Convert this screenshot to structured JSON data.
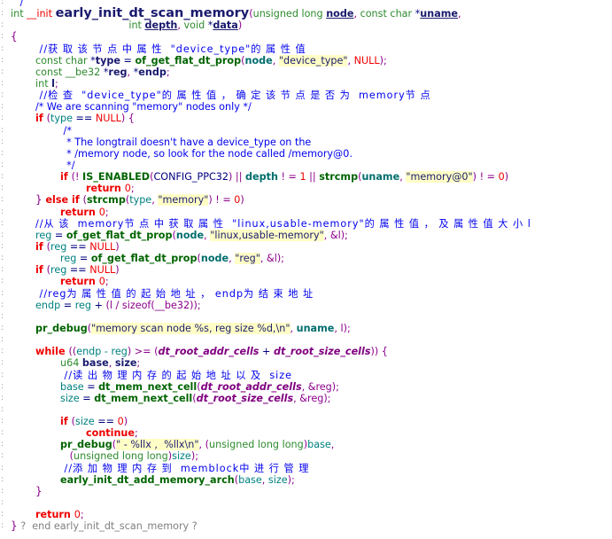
{
  "editor": {
    "gutter_mark": ":",
    "lines": [
      {
        "lv": 0,
        "tk": [
          [
            "   /",
            "c"
          ]
        ]
      },
      {
        "lv": 0,
        "tk": [
          [
            "int ",
            "t"
          ],
          [
            "__init ",
            "k0"
          ],
          [
            "early_init_dt_scan_memory",
            "fnbig"
          ],
          [
            "(",
            "p"
          ],
          [
            "unsigned long ",
            "t"
          ],
          [
            "node",
            "vu"
          ],
          [
            ", ",
            "p"
          ],
          [
            "const char ",
            "t"
          ],
          [
            "*",
            "x"
          ],
          [
            "uname",
            "vu"
          ],
          [
            ",",
            "p"
          ]
        ]
      },
      {
        "lv": 4,
        "tk": [
          [
            "      int ",
            "t"
          ],
          [
            "depth",
            "vu"
          ],
          [
            ", ",
            "p"
          ],
          [
            "void ",
            "t"
          ],
          [
            "*",
            "x"
          ],
          [
            "data",
            "vu"
          ],
          [
            ")",
            "p"
          ]
        ]
      },
      {
        "lv": 0,
        "tk": [
          [
            "{",
            "br"
          ]
        ]
      },
      {
        "lv": 1,
        "tk": [
          [
            " //获 取 该 节 点 中 属 性  \"device_type\"的 属 性 值",
            "cz"
          ]
        ]
      },
      {
        "lv": 1,
        "tk": [
          [
            "const char ",
            "t"
          ],
          [
            "*",
            "x"
          ],
          [
            "type",
            "v"
          ],
          [
            " = ",
            "x"
          ],
          [
            "of_get_flat_dt_prop",
            "f"
          ],
          [
            "(",
            "p"
          ],
          [
            "node",
            "tv"
          ],
          [
            ", ",
            "p"
          ],
          [
            "\"device_type\"",
            "s"
          ],
          [
            ", ",
            "p"
          ],
          [
            "NULL",
            "n"
          ],
          [
            ");",
            "p"
          ]
        ]
      },
      {
        "lv": 1,
        "tk": [
          [
            "const __be32 ",
            "t"
          ],
          [
            "*",
            "x"
          ],
          [
            "reg",
            "v"
          ],
          [
            ", ",
            "p"
          ],
          [
            "*",
            "x"
          ],
          [
            "endp",
            "v"
          ],
          [
            ";",
            "p"
          ]
        ]
      },
      {
        "lv": 1,
        "tk": [
          [
            "int ",
            "t"
          ],
          [
            "l",
            "v"
          ],
          [
            ";",
            "p"
          ]
        ]
      },
      {
        "lv": 1,
        "tk": [
          [
            " //检 查  \"device_type\"的 属 性 值 ， 确 定 该 节 点 是 否 为  memory节 点",
            "cz"
          ]
        ]
      },
      {
        "lv": 1,
        "tk": [
          [
            "/* We are scanning \"memory\" nodes only */",
            "c"
          ]
        ]
      },
      {
        "lv": 1,
        "tk": [
          [
            "if ",
            "k"
          ],
          [
            "(",
            "p"
          ],
          [
            "type",
            "l"
          ],
          [
            " == ",
            "x"
          ],
          [
            "NULL",
            "n"
          ],
          [
            ") {",
            "p"
          ]
        ]
      },
      {
        "lv": 2,
        "tk": [
          [
            " /*",
            "c"
          ]
        ]
      },
      {
        "lv": 2,
        "tk": [
          [
            "  * The longtrail doesn't have a device_type on the",
            "c"
          ]
        ]
      },
      {
        "lv": 2,
        "tk": [
          [
            "  * /memory node, so look for the node called /memory@0.",
            "c"
          ]
        ]
      },
      {
        "lv": 2,
        "tk": [
          [
            "  */",
            "c"
          ]
        ]
      },
      {
        "lv": 2,
        "tk": [
          [
            "if ",
            "k"
          ],
          [
            "(",
            "p"
          ],
          [
            "! ",
            "p"
          ],
          [
            "IS_ENABLED",
            "f"
          ],
          [
            "(",
            "p"
          ],
          [
            "CONFIG_PPC32",
            "x"
          ],
          [
            ") || ",
            "p"
          ],
          [
            "depth",
            "tv"
          ],
          [
            " ! = ",
            "p"
          ],
          [
            "1",
            "n"
          ],
          [
            " || ",
            "p"
          ],
          [
            "strcmp",
            "f"
          ],
          [
            "(",
            "p"
          ],
          [
            "uname",
            "tv"
          ],
          [
            ", ",
            "p"
          ],
          [
            "\"memory@0\"",
            "s"
          ],
          [
            ") ! = ",
            "p"
          ],
          [
            "0",
            "n"
          ],
          [
            ")",
            "p"
          ]
        ]
      },
      {
        "lv": 3,
        "tk": [
          [
            "return ",
            "k"
          ],
          [
            "0",
            "n"
          ],
          [
            ";",
            "p"
          ]
        ]
      },
      {
        "lv": 1,
        "tk": [
          [
            "} ",
            "br"
          ],
          [
            "else if ",
            "k"
          ],
          [
            "(",
            "p"
          ],
          [
            "strcmp",
            "f"
          ],
          [
            "(",
            "p"
          ],
          [
            "type",
            "l"
          ],
          [
            ", ",
            "p"
          ],
          [
            "\"memory\"",
            "s"
          ],
          [
            ") ! = ",
            "p"
          ],
          [
            "0",
            "n"
          ],
          [
            ")",
            "p"
          ]
        ]
      },
      {
        "lv": 2,
        "tk": [
          [
            "return ",
            "k"
          ],
          [
            "0",
            "n"
          ],
          [
            ";",
            "p"
          ]
        ]
      },
      {
        "lv": 1,
        "tk": [
          [
            "//从 该  memory节 点 中 获 取 属 性  \"linux,usable-memory\"的 属 性 值 ， 及 属 性 值 大 小 l",
            "cz"
          ]
        ]
      },
      {
        "lv": 1,
        "tk": [
          [
            "reg",
            "l"
          ],
          [
            " = ",
            "x"
          ],
          [
            "of_get_flat_dt_prop",
            "f"
          ],
          [
            "(",
            "p"
          ],
          [
            "node",
            "tv"
          ],
          [
            ", ",
            "p"
          ],
          [
            "\"linux,usable-memory\"",
            "s"
          ],
          [
            ", &l);",
            "p"
          ]
        ]
      },
      {
        "lv": 1,
        "tk": [
          [
            "if ",
            "k"
          ],
          [
            "(",
            "p"
          ],
          [
            "reg",
            "l"
          ],
          [
            " == ",
            "x"
          ],
          [
            "NULL",
            "n"
          ],
          [
            ")",
            "p"
          ]
        ]
      },
      {
        "lv": 2,
        "tk": [
          [
            "reg",
            "l"
          ],
          [
            " = ",
            "x"
          ],
          [
            "of_get_flat_dt_prop",
            "f"
          ],
          [
            "(",
            "p"
          ],
          [
            "node",
            "tv"
          ],
          [
            ", ",
            "p"
          ],
          [
            "\"reg\"",
            "s"
          ],
          [
            ", &l);",
            "p"
          ]
        ]
      },
      {
        "lv": 1,
        "tk": [
          [
            "if ",
            "k"
          ],
          [
            "(",
            "p"
          ],
          [
            "reg",
            "l"
          ],
          [
            " == ",
            "x"
          ],
          [
            "NULL",
            "n"
          ],
          [
            ")",
            "p"
          ]
        ]
      },
      {
        "lv": 2,
        "tk": [
          [
            "return ",
            "k"
          ],
          [
            "0",
            "n"
          ],
          [
            ";",
            "p"
          ]
        ]
      },
      {
        "lv": 1,
        "tk": [
          [
            " //reg为 属 性 值 的 起 始 地 址 ， endp为 结 束 地 址",
            "cz"
          ]
        ]
      },
      {
        "lv": 1,
        "tk": [
          [
            "endp",
            "l"
          ],
          [
            " = ",
            "x"
          ],
          [
            "reg",
            "l"
          ],
          [
            " + ",
            "x"
          ],
          [
            "(l / sizeof(__be32));",
            "p"
          ]
        ]
      },
      {
        "lv": 1,
        "tk": []
      },
      {
        "lv": 1,
        "tk": [
          [
            "pr_debug",
            "f"
          ],
          [
            "(",
            "p"
          ],
          [
            "\"memory scan node %s, reg size %d,\\n\"",
            "s"
          ],
          [
            ", ",
            "p"
          ],
          [
            "uname",
            "tv"
          ],
          [
            ", l);",
            "p"
          ]
        ]
      },
      {
        "lv": 1,
        "tk": []
      },
      {
        "lv": 1,
        "tk": [
          [
            "while ",
            "k"
          ],
          [
            "((",
            "p"
          ],
          [
            "endp - reg",
            "l"
          ],
          [
            ") >= (",
            "p"
          ],
          [
            "dt_root_addr_cells",
            "m"
          ],
          [
            " + ",
            "x"
          ],
          [
            "dt_root_size_cells",
            "m"
          ],
          [
            ")) {",
            "p"
          ]
        ]
      },
      {
        "lv": 2,
        "tk": [
          [
            "u64 ",
            "t"
          ],
          [
            "base",
            "v"
          ],
          [
            ", ",
            "p"
          ],
          [
            "size",
            "v"
          ],
          [
            ";",
            "p"
          ]
        ]
      },
      {
        "lv": 2,
        "tk": [
          [
            " //读 出 物 理 内 存 的 起 始 地 址 以 及  size",
            "cz"
          ]
        ]
      },
      {
        "lv": 2,
        "tk": [
          [
            "base",
            "l"
          ],
          [
            " = ",
            "x"
          ],
          [
            "dt_mem_next_cell",
            "f"
          ],
          [
            "(",
            "p"
          ],
          [
            "dt_root_addr_cells",
            "m"
          ],
          [
            ", &reg);",
            "p"
          ]
        ]
      },
      {
        "lv": 2,
        "tk": [
          [
            "size",
            "l"
          ],
          [
            " = ",
            "x"
          ],
          [
            "dt_mem_next_cell",
            "f"
          ],
          [
            "(",
            "p"
          ],
          [
            "dt_root_size_cells",
            "m"
          ],
          [
            ", &reg);",
            "p"
          ]
        ]
      },
      {
        "lv": 2,
        "tk": []
      },
      {
        "lv": 2,
        "tk": [
          [
            "if ",
            "k"
          ],
          [
            "(",
            "p"
          ],
          [
            "size",
            "l"
          ],
          [
            " == ",
            "x"
          ],
          [
            "0",
            "n"
          ],
          [
            ")",
            "p"
          ]
        ]
      },
      {
        "lv": 3,
        "tk": [
          [
            "continue",
            "k"
          ],
          [
            ";",
            "p"
          ]
        ]
      },
      {
        "lv": 2,
        "tk": [
          [
            "pr_debug",
            "f"
          ],
          [
            "(",
            "p"
          ],
          [
            "\" - %llx ,  %llx\\n\"",
            "s"
          ],
          [
            ", (",
            "p"
          ],
          [
            "unsigned long long",
            "t"
          ],
          [
            ")",
            "p"
          ],
          [
            "base",
            "l"
          ],
          [
            ",",
            "p"
          ]
        ]
      },
      {
        "lv": 2,
        "tk": [
          [
            "   (",
            "p"
          ],
          [
            "unsigned long long",
            "t"
          ],
          [
            ")",
            "p"
          ],
          [
            "size",
            "l"
          ],
          [
            ");",
            "p"
          ]
        ]
      },
      {
        "lv": 2,
        "tk": [
          [
            " //添 加 物 理 内 存 到  memblock中 进 行 管 理",
            "cz"
          ]
        ]
      },
      {
        "lv": 2,
        "tk": [
          [
            "early_init_dt_add_memory_arch",
            "f"
          ],
          [
            "(",
            "p"
          ],
          [
            "base",
            "l"
          ],
          [
            ", ",
            "p"
          ],
          [
            "size",
            "l"
          ],
          [
            ");",
            "p"
          ]
        ]
      },
      {
        "lv": 1,
        "tk": [
          [
            "}",
            "br"
          ]
        ]
      },
      {
        "lv": 1,
        "tk": []
      },
      {
        "lv": 1,
        "tk": [
          [
            "return ",
            "k"
          ],
          [
            "0",
            "n"
          ],
          [
            ";",
            "p"
          ]
        ]
      },
      {
        "lv": 0,
        "tk": [
          [
            "}",
            "br"
          ],
          [
            " ?  end early_init_dt_scan_memory ?",
            "g"
          ]
        ]
      }
    ]
  }
}
